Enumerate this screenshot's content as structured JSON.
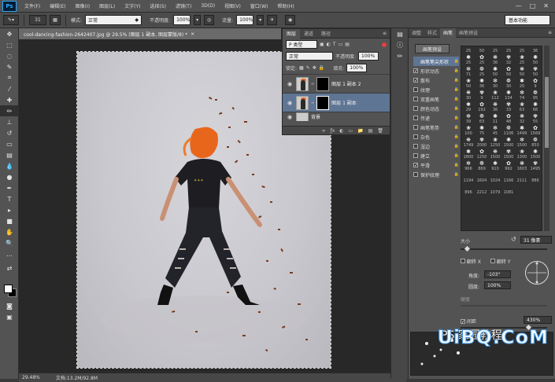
{
  "app": {
    "logo": "Ps"
  },
  "menu": [
    "文件(F)",
    "编辑(E)",
    "图像(I)",
    "图层(L)",
    "文字(Y)",
    "选择(S)",
    "滤镜(T)",
    "3D(D)",
    "视图(V)",
    "窗口(W)",
    "帮助(H)"
  ],
  "window_controls": [
    "—",
    "□",
    "✕"
  ],
  "options_bar": {
    "brush_size": "31",
    "mode_label": "模式:",
    "mode_value": "正常",
    "opacity_label": "不透明度:",
    "opacity_value": "100%",
    "flow_label": "流量:",
    "flow_value": "100%",
    "workspace": "基本功能"
  },
  "document": {
    "tab_title": "cool-dancing-fashion-2642407.jpg @ 29.5% (图层 1 副本, 图层蒙版/8) *",
    "close": "×",
    "zoom": "29.48%",
    "doc_size": "文档:13.2M/92.8M"
  },
  "layers_panel": {
    "tabs": [
      "图层",
      "通道",
      "路径"
    ],
    "filter_kind": "P 类型",
    "blend_mode": "正常",
    "opacity_label": "不透明度:",
    "opacity_value": "100%",
    "lock_label": "锁定:",
    "fill_label": "填充:",
    "fill_value": "100%",
    "layers": [
      {
        "name": "图层 1 副本 2",
        "selected": false
      },
      {
        "name": "图层 1 副本",
        "selected": true
      },
      {
        "name": "背景",
        "selected": false
      }
    ],
    "footer_icons": [
      "ƒx",
      "◐",
      "▭",
      "📁",
      "▤",
      "🗑"
    ]
  },
  "brush_panel": {
    "tabs": [
      "调整",
      "样式",
      "画笔",
      "画笔预设"
    ],
    "preset_button": "画笔预设",
    "options": [
      {
        "label": "画笔笔尖形状",
        "checked": false,
        "highlight": true
      },
      {
        "label": "形状动态",
        "checked": true,
        "highlight": false
      },
      {
        "label": "散布",
        "checked": true,
        "highlight": false
      },
      {
        "label": "纹理",
        "checked": false,
        "highlight": false
      },
      {
        "label": "双重画笔",
        "checked": false,
        "highlight": false
      },
      {
        "label": "颜色动态",
        "checked": false,
        "highlight": false
      },
      {
        "label": "传递",
        "checked": false,
        "highlight": false
      },
      {
        "label": "画笔笔势",
        "checked": false,
        "highlight": false
      },
      {
        "label": "杂色",
        "checked": false,
        "highlight": false
      },
      {
        "label": "湿边",
        "checked": false,
        "highlight": false
      },
      {
        "label": "建立",
        "checked": false,
        "highlight": false
      },
      {
        "label": "平滑",
        "checked": true,
        "highlight": false
      },
      {
        "label": "保护纹理",
        "checked": false,
        "highlight": false
      }
    ],
    "brush_sizes": [
      "25",
      "50",
      "25",
      "25",
      "25",
      "36",
      "25",
      "25",
      "36",
      "32",
      "25",
      "50",
      "71",
      "25",
      "50",
      "50",
      "50",
      "50",
      "50",
      "36",
      "30",
      "30",
      "20",
      "9",
      "30",
      "9",
      "112",
      "134",
      "74",
      "95",
      "29",
      "192",
      "36",
      "33",
      "63",
      "66",
      "39",
      "63",
      "11",
      "48",
      "32",
      "55",
      "100",
      "75",
      "45",
      "1106",
      "1499",
      "1569",
      "1749",
      "2000",
      "1250",
      "1500",
      "1500",
      "850",
      "1800",
      "1250",
      "1500",
      "1500",
      "1300",
      "1500"
    ],
    "grid_numbers": [
      "966",
      "869",
      "910",
      "992",
      "1603",
      "1495",
      "1194",
      "1604",
      "1024",
      "1166",
      "2111",
      "886",
      "896",
      "2212",
      "1079",
      "1081"
    ],
    "size_label": "大小",
    "size_value": "31 像素",
    "flip_x": "翻转 X",
    "flip_y": "翻转 Y",
    "angle_label": "角度:",
    "angle_value": "-103°",
    "roundness_label": "圆度:",
    "roundness_value": "100%",
    "hardness_label": "硬度",
    "spacing_label": "间距",
    "spacing_checked": true,
    "spacing_value": "430%"
  },
  "watermark": {
    "text": "UiBQ.CoM",
    "sub": "PS 家园教程"
  }
}
